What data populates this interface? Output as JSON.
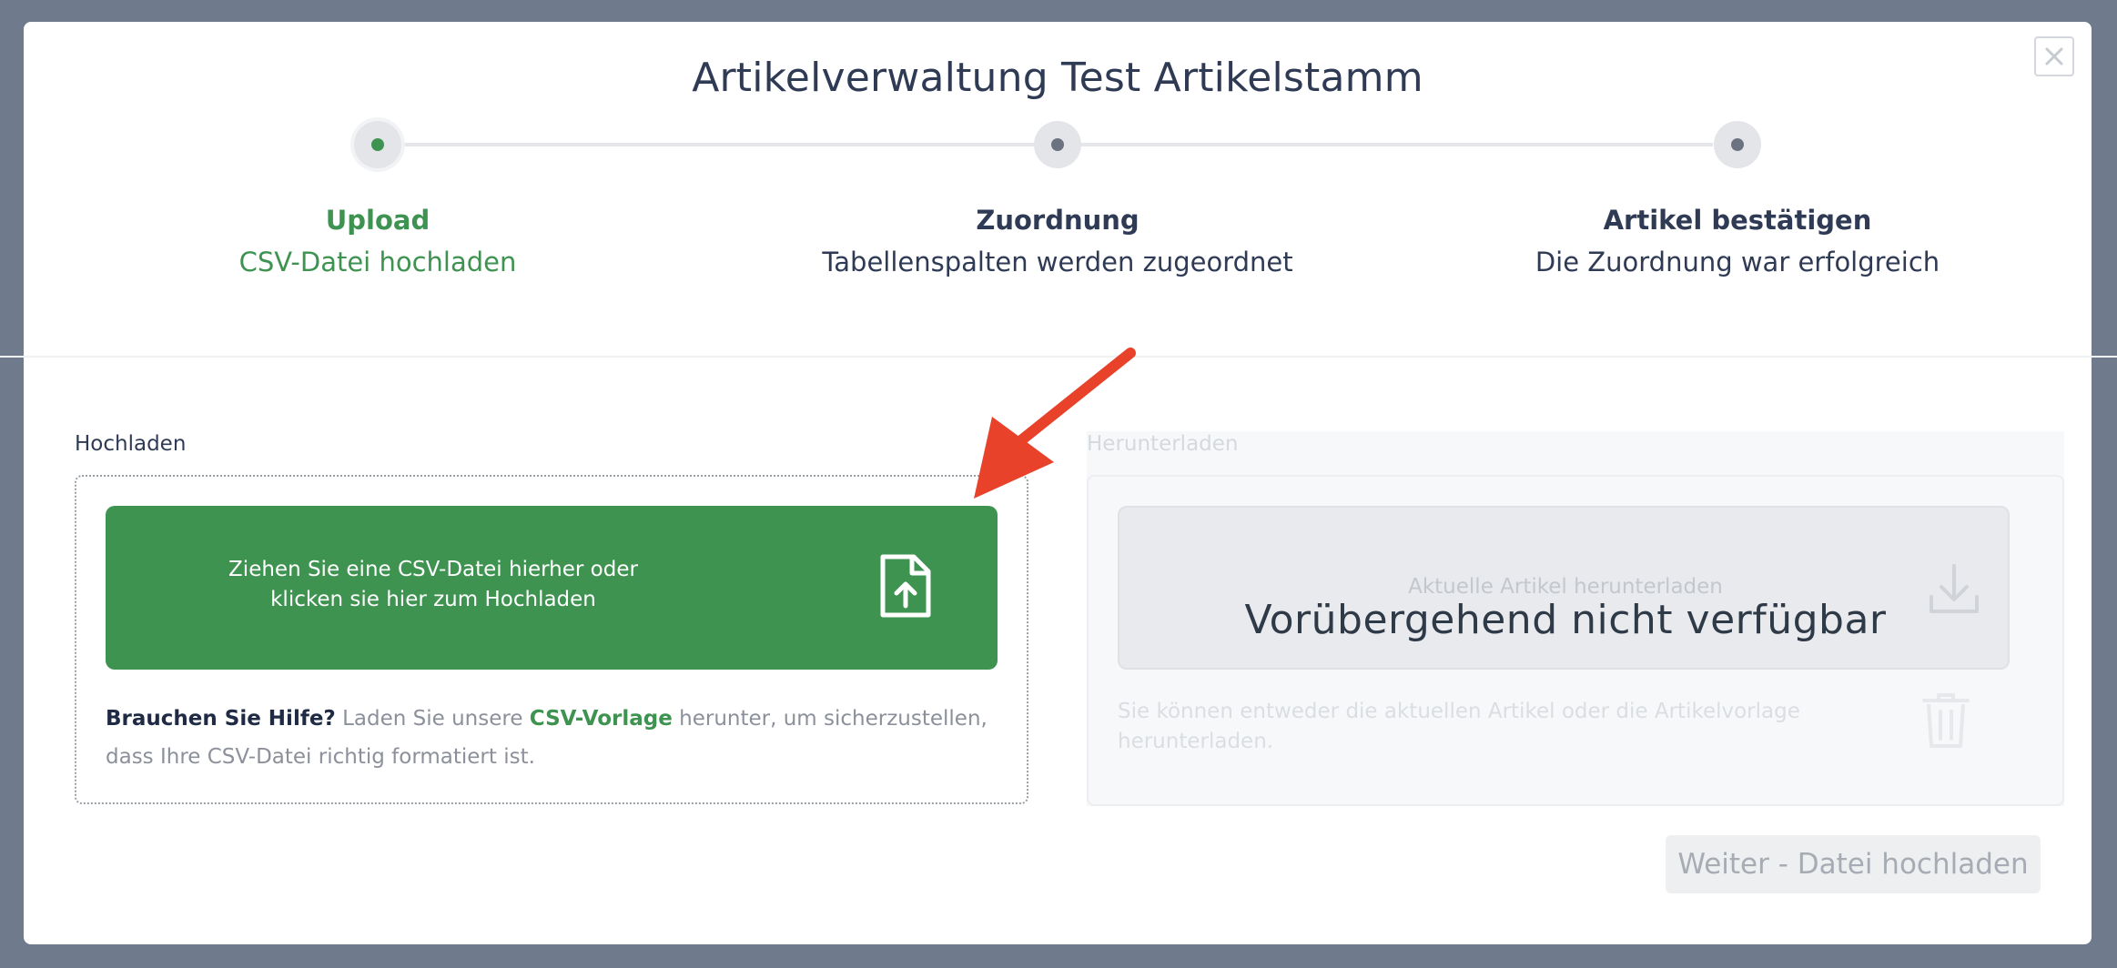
{
  "modal": {
    "title": "Artikelverwaltung Test Artikelstamm",
    "close_icon": "close-icon"
  },
  "stepper": {
    "steps": [
      {
        "title": "Upload",
        "subtitle": "CSV-Datei hochladen",
        "active": true
      },
      {
        "title": "Zuordnung",
        "subtitle": "Tabellenspalten werden zugeordnet",
        "active": false
      },
      {
        "title": "Artikel bestätigen",
        "subtitle": "Die Zuordnung war erfolgreich",
        "active": false
      }
    ]
  },
  "upload": {
    "label": "Hochladen",
    "dropzone_text": "Ziehen Sie eine CSV-Datei hierher oder klicken sie hier zum Hochladen",
    "icon": "file-upload-icon",
    "help_strong": "Brauchen Sie Hilfe?",
    "help_before": "Laden Sie unsere",
    "help_link": "CSV-Vorlage",
    "help_after": "herunter, um sicherzustellen, dass Ihre CSV-Datei richtig formatiert ist."
  },
  "download": {
    "label": "Herunterladen",
    "button_label": "Aktuelle Artikel herunterladen",
    "unavailable_text": "Vorübergehend nicht verfügbar",
    "icon": "download-icon",
    "hint": "Sie können entweder die aktuellen Artikel oder die Artikelvorlage herunterladen.",
    "trash_icon": "trash-icon"
  },
  "footer": {
    "next_button": "Weiter - Datei hochladen"
  },
  "colors": {
    "accent": "#3e9350",
    "backdrop": "#6f7b8c",
    "text": "#2f3a55",
    "arrow": "#e8422b"
  }
}
